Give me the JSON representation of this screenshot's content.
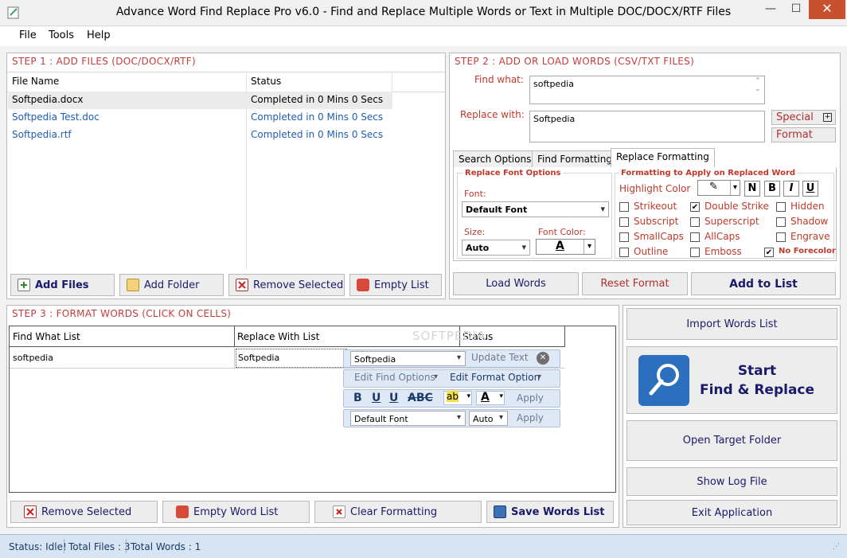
{
  "window": {
    "title": "Advance Word Find Replace Pro v6.0 - Find and Replace Multiple Words or Text in Multiple DOC/DOCX/RTF Files"
  },
  "menu": {
    "items": [
      "File",
      "Tools",
      "Help"
    ]
  },
  "step1": {
    "title": "STEP 1 : ADD FILES (DOC/DOCX/RTF)",
    "columns": [
      "File Name",
      "Status"
    ],
    "rows": [
      {
        "file": "Softpedia.docx",
        "status": "Completed in 0 Mins 0 Secs"
      },
      {
        "file": "Softpedia Test.doc",
        "status": "Completed in 0 Mins 0 Secs"
      },
      {
        "file": "Softpedia.rtf",
        "status": "Completed in 0 Mins 0 Secs"
      }
    ],
    "buttons": {
      "add_files": "Add Files",
      "add_folder": "Add Folder",
      "remove_selected": "Remove Selected",
      "empty_list": "Empty List"
    }
  },
  "step2": {
    "title": "STEP 2 : ADD OR LOAD WORDS (CSV/TXT FILES)",
    "find_label": "Find what:",
    "find_value": "softpedia",
    "replace_label": "Replace with:",
    "replace_value": "Softpedia",
    "special": "Special",
    "format": "Format",
    "tabs": [
      "Search Options",
      "Find Formatting",
      "Replace Formatting"
    ],
    "font_group": "Replace Font Options",
    "font_label": "Font:",
    "font_value": "Default Font",
    "size_label": "Size:",
    "size_value": "Auto",
    "fontcolor_label": "Font Color:",
    "fmt_group": "Formatting to Apply on Replaced Word",
    "highlight_label": "Highlight Color",
    "fmt_n": "N",
    "fmt_b": "B",
    "fmt_i": "I",
    "fmt_u": "U",
    "checks": [
      {
        "label": "Strikeout",
        "checked": false
      },
      {
        "label": "Double Strike",
        "checked": true
      },
      {
        "label": "Hidden",
        "checked": false
      },
      {
        "label": "Subscript",
        "checked": false
      },
      {
        "label": "Superscript",
        "checked": false
      },
      {
        "label": "Shadow",
        "checked": false
      },
      {
        "label": "SmallCaps",
        "checked": false
      },
      {
        "label": "AllCaps",
        "checked": false
      },
      {
        "label": "Engrave",
        "checked": false
      },
      {
        "label": "Outline",
        "checked": false
      },
      {
        "label": "Emboss",
        "checked": false
      },
      {
        "label": "No Forecolor",
        "checked": true
      }
    ],
    "buttons": {
      "load_words": "Load Words",
      "reset_format": "Reset Format",
      "add_to_list": "Add to List"
    }
  },
  "step3": {
    "title": "STEP 3 : FORMAT WORDS (CLICK ON CELLS)",
    "columns": [
      "Find What List",
      "Replace With List",
      "Status"
    ],
    "rows": [
      {
        "find": "softpedia",
        "replace": "Softpedia",
        "status": ""
      }
    ],
    "watermark": "SOFTPEDIA",
    "editor": {
      "text_value": "Softpedia",
      "update_text": "Update Text",
      "edit_find_options": "Edit Find Options",
      "edit_format_option": "Edit Format Option",
      "bold": "B",
      "underline": "U",
      "strike": "ABC",
      "apply": "Apply",
      "font_value": "Default Font",
      "size_value": "Auto"
    },
    "buttons": {
      "remove_selected": "Remove Selected",
      "empty_word_list": "Empty Word List",
      "clear_formatting": "Clear Formatting",
      "save_words_list": "Save Words List"
    }
  },
  "right_panel": {
    "import_words_list": "Import Words List",
    "start_line1": "Start",
    "start_line2": "Find & Replace",
    "open_target_folder": "Open Target Folder",
    "show_log_file": "Show Log File",
    "exit_application": "Exit Application"
  },
  "status": {
    "status_text": "Status:  Idle!",
    "total_files": "Total Files : 3",
    "total_words": "Total Words : 1"
  },
  "colors": {
    "accent_red": "#c33c3c",
    "link_blue": "#1f5db3",
    "button_text": "#1a1a6b",
    "status_bg": "#d7e4f2"
  }
}
